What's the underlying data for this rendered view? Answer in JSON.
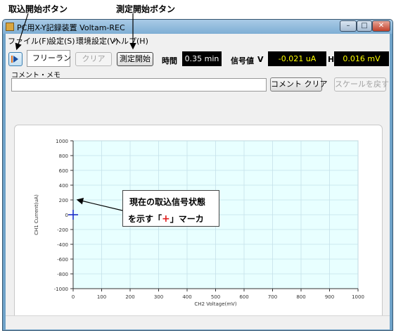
{
  "annotations": {
    "capture_button_label": "取込開始ボタン",
    "measure_button_label": "測定開始ボタン",
    "callout_line1": "現在の取込信号状態",
    "callout_line2_pre": "を示す「",
    "callout_marker": "+",
    "callout_line2_post": "」マーカ"
  },
  "window": {
    "title": "PC用X-Y記録装置   Voltam-REC"
  },
  "menu": [
    "ファイル(F)",
    "設定(S)",
    "環境設定(V)",
    "ヘルプ(H)"
  ],
  "toolbar": {
    "capture_icon": "play-icon",
    "mode_value": "フリーラン",
    "clear_label": "クリア",
    "measure_label": "測定開始",
    "time_label": "時間",
    "time_value": "0.35 min",
    "signal_label": "信号値",
    "v_label": "V",
    "v_value": "-0.021 uA",
    "h_label": "H",
    "h_value": "0.016 mV"
  },
  "comment": {
    "label": "コメント・メモ",
    "value": "",
    "clear_label": "コメント クリア",
    "reset_scale_label": "スケールを戻す"
  },
  "chart_data": {
    "type": "scatter",
    "xlabel": "CH2   Voltage(mV)",
    "ylabel": "CH1   Current(uA)",
    "xlim": [
      0,
      1000
    ],
    "ylim": [
      -1000,
      1000
    ],
    "xticks": [
      0,
      100,
      200,
      300,
      400,
      500,
      600,
      700,
      800,
      900,
      1000
    ],
    "yticks": [
      1000,
      800,
      600,
      400,
      200,
      0,
      -200,
      -400,
      -600,
      -800,
      -1000
    ],
    "grid": true,
    "background": "#e8ffff",
    "grid_color": "#c5e1ea",
    "marker": {
      "x": 0,
      "y": 0,
      "color": "#1a2ec8"
    }
  },
  "colors": {
    "callout_marker": "#e02020"
  }
}
